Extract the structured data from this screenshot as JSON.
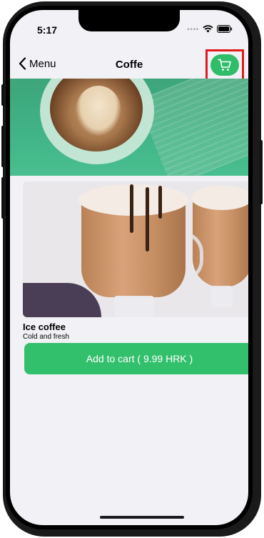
{
  "status": {
    "time": "5:17"
  },
  "nav": {
    "back_label": "Menu",
    "title": "Coffe"
  },
  "product": {
    "name": "Ice coffee",
    "description": "Cold and fresh",
    "add_to_cart_label": "Add to cart ( 9.99 HRK )"
  },
  "colors": {
    "accent": "#33c06d",
    "highlight": "#e01b1b"
  },
  "icons": {
    "back": "chevron-left-icon",
    "cart": "cart-icon",
    "wifi": "wifi-icon",
    "battery": "battery-icon"
  }
}
